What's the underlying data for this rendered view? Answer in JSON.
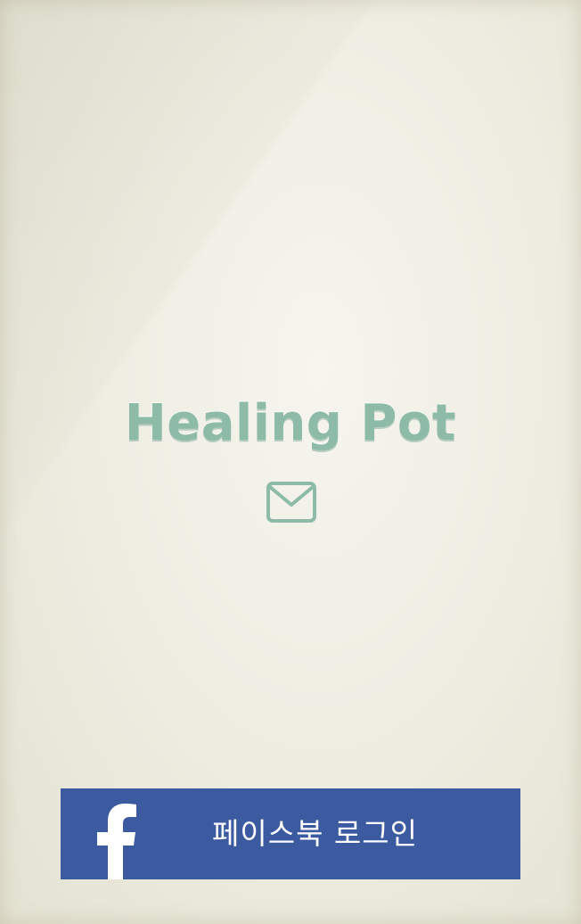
{
  "app": {
    "title": "Healing Pot"
  },
  "actions": {
    "mail_icon": "envelope-icon",
    "facebook_login_label": "페이스북 로그인",
    "facebook_icon": "facebook-f-icon"
  },
  "colors": {
    "title": "#8dbba7",
    "facebook_blue": "#3b5aa0",
    "background": "#efeee3"
  }
}
